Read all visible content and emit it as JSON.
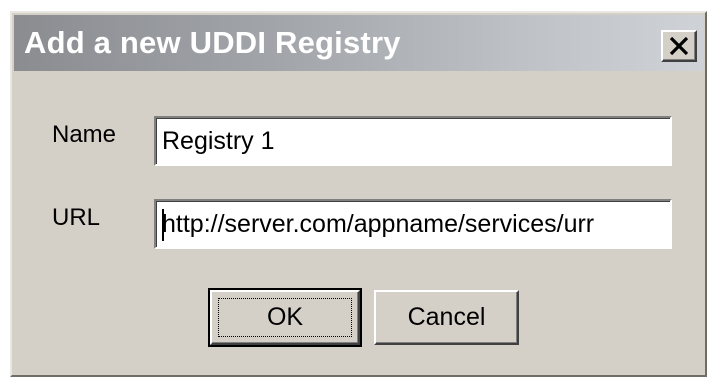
{
  "window": {
    "title": "Add a new UDDI Registry",
    "close_icon": "close-icon"
  },
  "form": {
    "name_label": "Name",
    "name_value": "Registry 1",
    "url_label": "URL",
    "url_value": "http://server.com/appname/services/urr"
  },
  "buttons": {
    "ok_label": "OK",
    "cancel_label": "Cancel"
  },
  "colors": {
    "dialog_face": "#d4d0c8",
    "titlebar_start": "#8a8c90",
    "titlebar_end": "#cfd2d6",
    "title_text": "#ffffff"
  }
}
